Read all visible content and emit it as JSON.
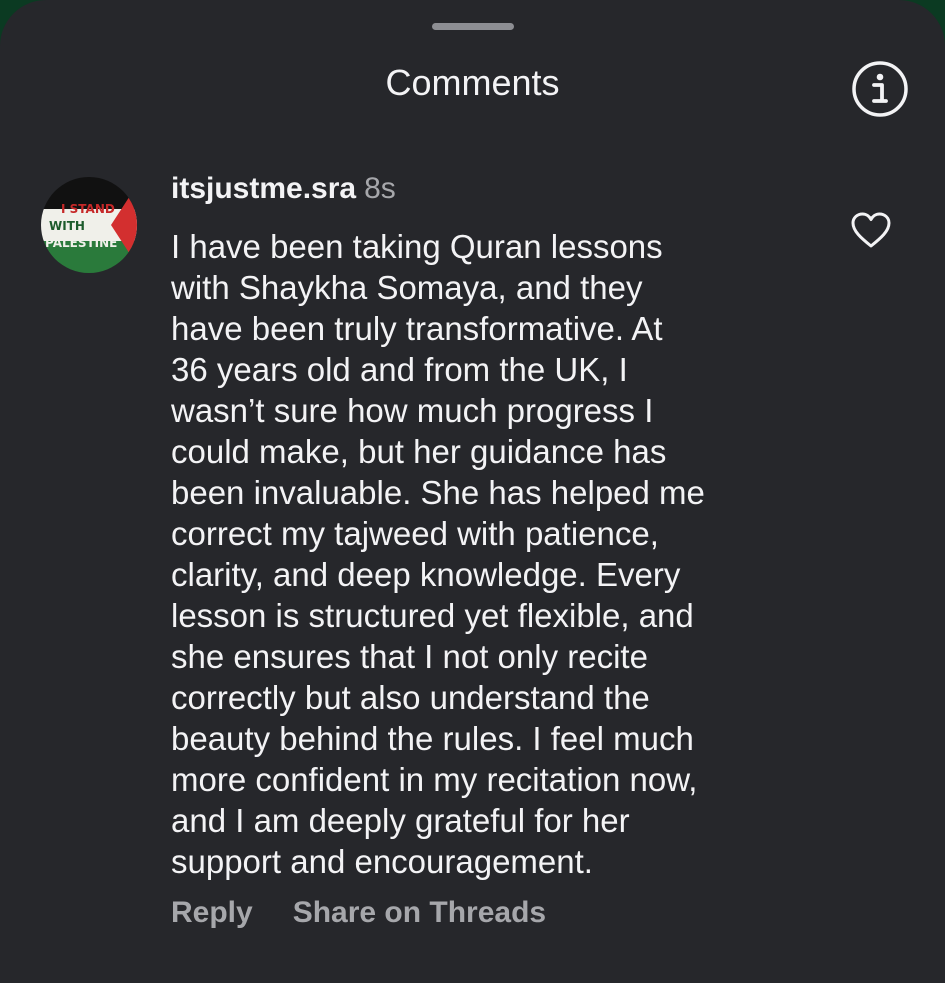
{
  "header": {
    "title": "Comments"
  },
  "icons": {
    "info": "info-icon",
    "heart": "heart-icon",
    "drag_handle": "drag-handle"
  },
  "comment": {
    "avatar": {
      "badge_text": [
        "I STAND",
        "WITH",
        "PALESTINE"
      ]
    },
    "username": "itsjustme.sra",
    "timestamp": "8s",
    "text": "I have been taking Quran lessons\nwith Shaykha Somaya, and they\nhave been truly transformative. At\n36 years old and from the UK, I\nwasn’t sure how much progress I\ncould make, but her guidance has\nbeen invaluable. She has helped me\ncorrect my tajweed with patience,\nclarity, and deep knowledge. Every\nlesson is structured yet flexible, and\nshe ensures that I not only recite\ncorrectly but also understand the\nbeauty behind the rules. I feel much\nmore confident in my recitation now,\nand I am deeply grateful for her\nsupport and encouragement.",
    "actions": {
      "reply": "Reply",
      "share": "Share on Threads"
    }
  },
  "colors": {
    "background": "#26272b",
    "text": "#f3f3f5",
    "muted": "#a6a7ab"
  }
}
